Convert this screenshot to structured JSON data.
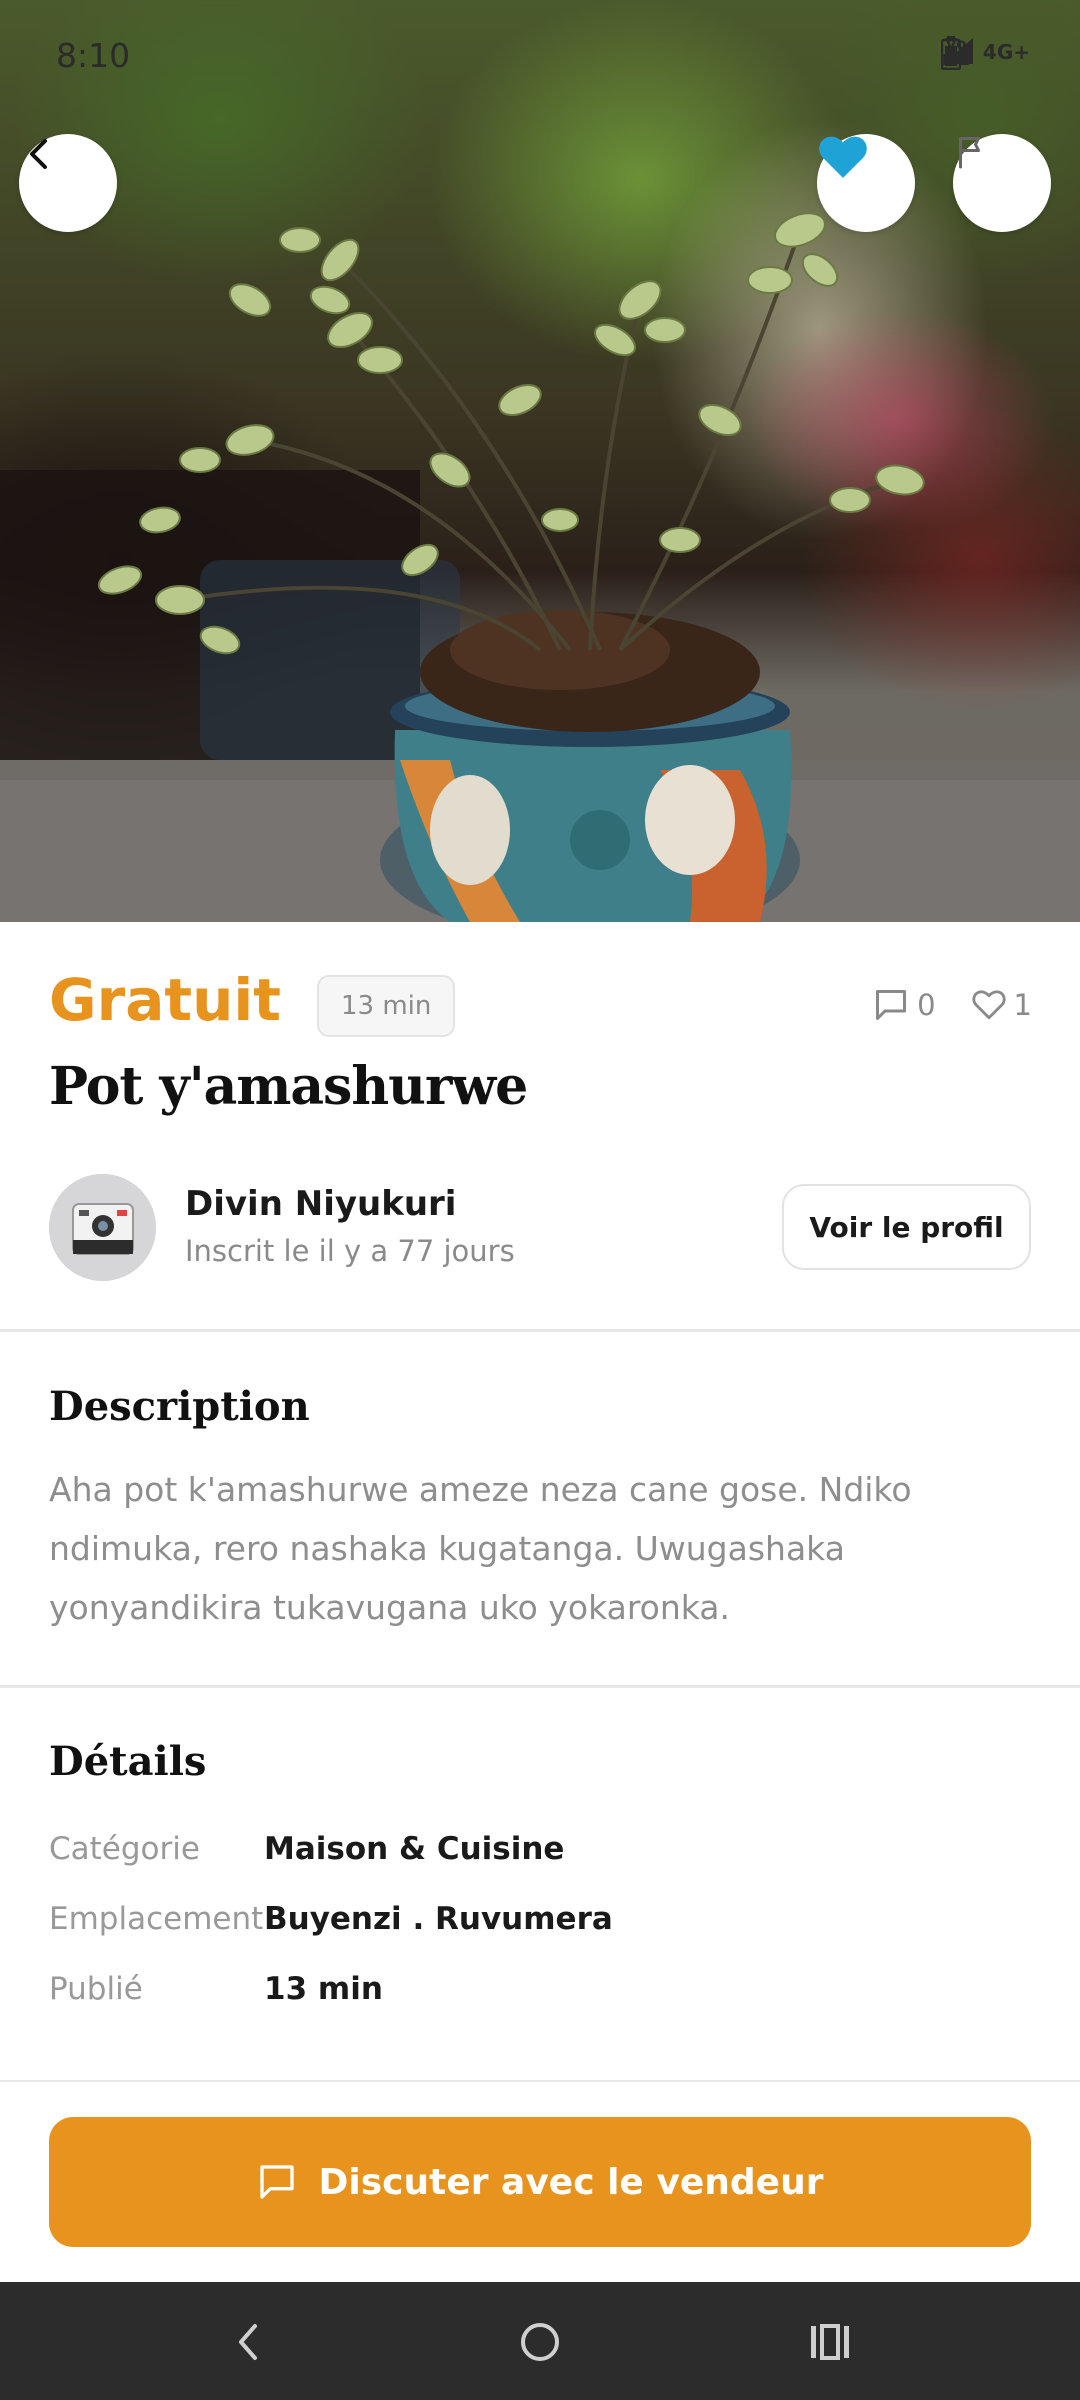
{
  "status_bar": {
    "time": "8:10",
    "volte": "Vo LTE",
    "network": "4G+"
  },
  "hero": {
    "image_alt": "Plant in ceramic pot",
    "favorited": true
  },
  "listing": {
    "price": "Gratuit",
    "age": "13 min",
    "comments_count": "0",
    "likes_count": "1",
    "title": "Pot y'amashurwe"
  },
  "seller": {
    "name": "Divin Niyukuri",
    "joined": "Inscrit le il y a 77 jours",
    "profile_button": "Voir le profil"
  },
  "description": {
    "heading": "Description",
    "text": "Aha pot k'amashurwe ameze neza cane gose. Ndiko ndimuka, rero nashaka kugatanga. Uwugashaka yonyandikira tukavugana uko yokaronka."
  },
  "details": {
    "heading": "Détails",
    "rows": [
      {
        "label": "Catégorie",
        "value": "Maison & Cuisine"
      },
      {
        "label": "Emplacement",
        "value": "Buyenzi . Ruvumera"
      },
      {
        "label": "Publié",
        "value": "13 min"
      }
    ]
  },
  "cta": {
    "label": "Discuter avec le vendeur"
  },
  "colors": {
    "accent": "#E8931E",
    "favorite": "#1FA3D6",
    "nav_bar": "#2c2c2c"
  }
}
